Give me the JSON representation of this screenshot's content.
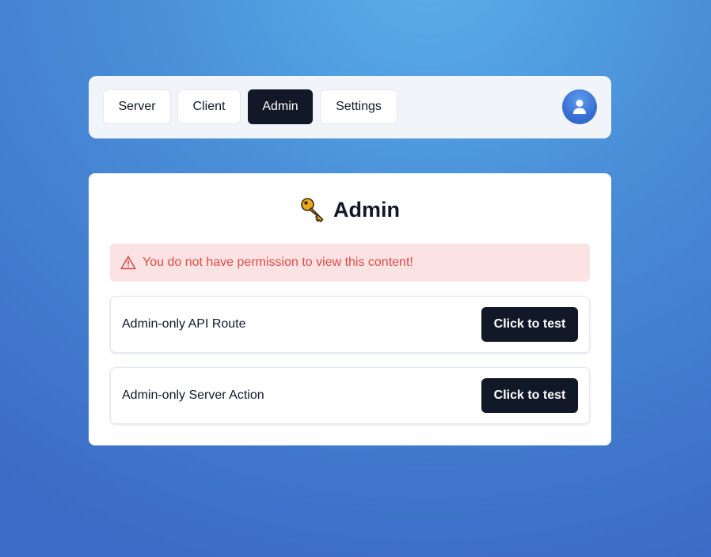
{
  "nav": {
    "tabs": [
      {
        "label": "Server",
        "active": false
      },
      {
        "label": "Client",
        "active": false
      },
      {
        "label": "Admin",
        "active": true
      },
      {
        "label": "Settings",
        "active": false
      }
    ],
    "avatar_icon": "user-icon"
  },
  "main": {
    "title_icon": "key-icon",
    "title": "Admin",
    "alert": {
      "icon": "warning-triangle-icon",
      "text": "You do not have permission to view this content!"
    },
    "actions": [
      {
        "label": "Admin-only API Route",
        "button_label": "Click to test"
      },
      {
        "label": "Admin-only Server Action",
        "button_label": "Click to test"
      }
    ]
  },
  "colors": {
    "accent_dark": "#111827",
    "alert_bg": "#fbe3e3",
    "alert_text": "#dc4a4a",
    "nav_bg": "#f1f5f9"
  }
}
